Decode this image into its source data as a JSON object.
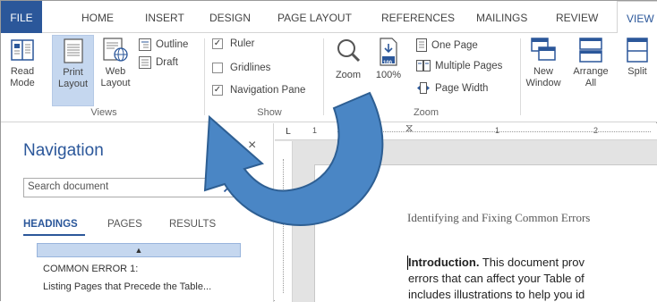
{
  "ribbon_tabs": {
    "file": "FILE",
    "home": "HOME",
    "insert": "INSERT",
    "design": "DESIGN",
    "page_layout": "PAGE LAYOUT",
    "references": "REFERENCES",
    "mailings": "MAILINGS",
    "review": "REVIEW",
    "view": "VIEW"
  },
  "views_group": {
    "label": "Views",
    "read_mode": [
      "Read",
      "Mode"
    ],
    "print_layout": [
      "Print",
      "Layout"
    ],
    "web_layout": [
      "Web",
      "Layout"
    ],
    "outline": "Outline",
    "draft": "Draft"
  },
  "show_group": {
    "label": "Show",
    "ruler": {
      "label": "Ruler",
      "checked": true
    },
    "gridlines": {
      "label": "Gridlines",
      "checked": false
    },
    "navigation_pane": {
      "label": "Navigation Pane",
      "checked": true
    }
  },
  "zoom_group": {
    "label": "Zoom",
    "zoom": "Zoom",
    "hundred": "100%",
    "hundred_badge": "100",
    "one_page": "One Page",
    "multiple_pages": "Multiple Pages",
    "page_width": "Page Width"
  },
  "window_group": {
    "new_window": [
      "New",
      "Window"
    ],
    "arrange_all": [
      "Arrange",
      "All"
    ],
    "split": "Split"
  },
  "navigation": {
    "title": "Navigation",
    "close": "×",
    "search_placeholder": "Search document",
    "tabs": {
      "headings": "HEADINGS",
      "pages": "PAGES",
      "results": "RESULTS"
    },
    "collapse_glyph": "▲",
    "items": [
      "COMMON ERROR 1:",
      "Listing Pages that Precede the Table..."
    ]
  },
  "ruler": {
    "corner": "L",
    "marks": [
      "1",
      "1",
      "2"
    ]
  },
  "document": {
    "heading": "Identifying and Fixing Common Errors",
    "intro_bold": "Introduction.",
    "line1": " This document prov",
    "line2": "errors that can affect your Table of",
    "line3": "includes illustrations to help you id"
  },
  "colors": {
    "accent": "#2b579a",
    "selection": "#c5d7ef",
    "arrow_fill": "#4a86c5"
  }
}
